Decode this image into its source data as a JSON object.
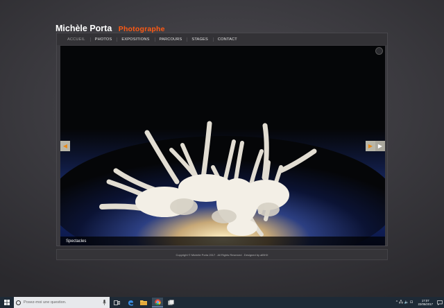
{
  "site": {
    "name": "Michèle Porta",
    "tagline": "Photographe"
  },
  "nav": {
    "items": [
      {
        "label": "ACCUEIL"
      },
      {
        "label": "PHOTOS"
      },
      {
        "label": "EXPOSITIONS"
      },
      {
        "label": "PARCOURS"
      },
      {
        "label": "STAGES"
      },
      {
        "label": "CONTACT"
      }
    ]
  },
  "slideshow": {
    "caption": "Spectacles",
    "pause_icon": "pause-circle-icon",
    "prev_icon": "arrow-left-icon",
    "next_icon": "arrow-right-icon"
  },
  "footer": {
    "copyright": "Copyright © Michèle Porta 2017 . All Rights Reserved . Designed by alBHX"
  },
  "taskbar": {
    "search_placeholder": "Posez-moi une question.",
    "tray_lang": "^ 🖧 🔈 ⊡",
    "time": "17:07",
    "date": "22/05/2017",
    "colors": {
      "taskbar": "#1e2a36",
      "accent": "#ff5a14"
    }
  }
}
